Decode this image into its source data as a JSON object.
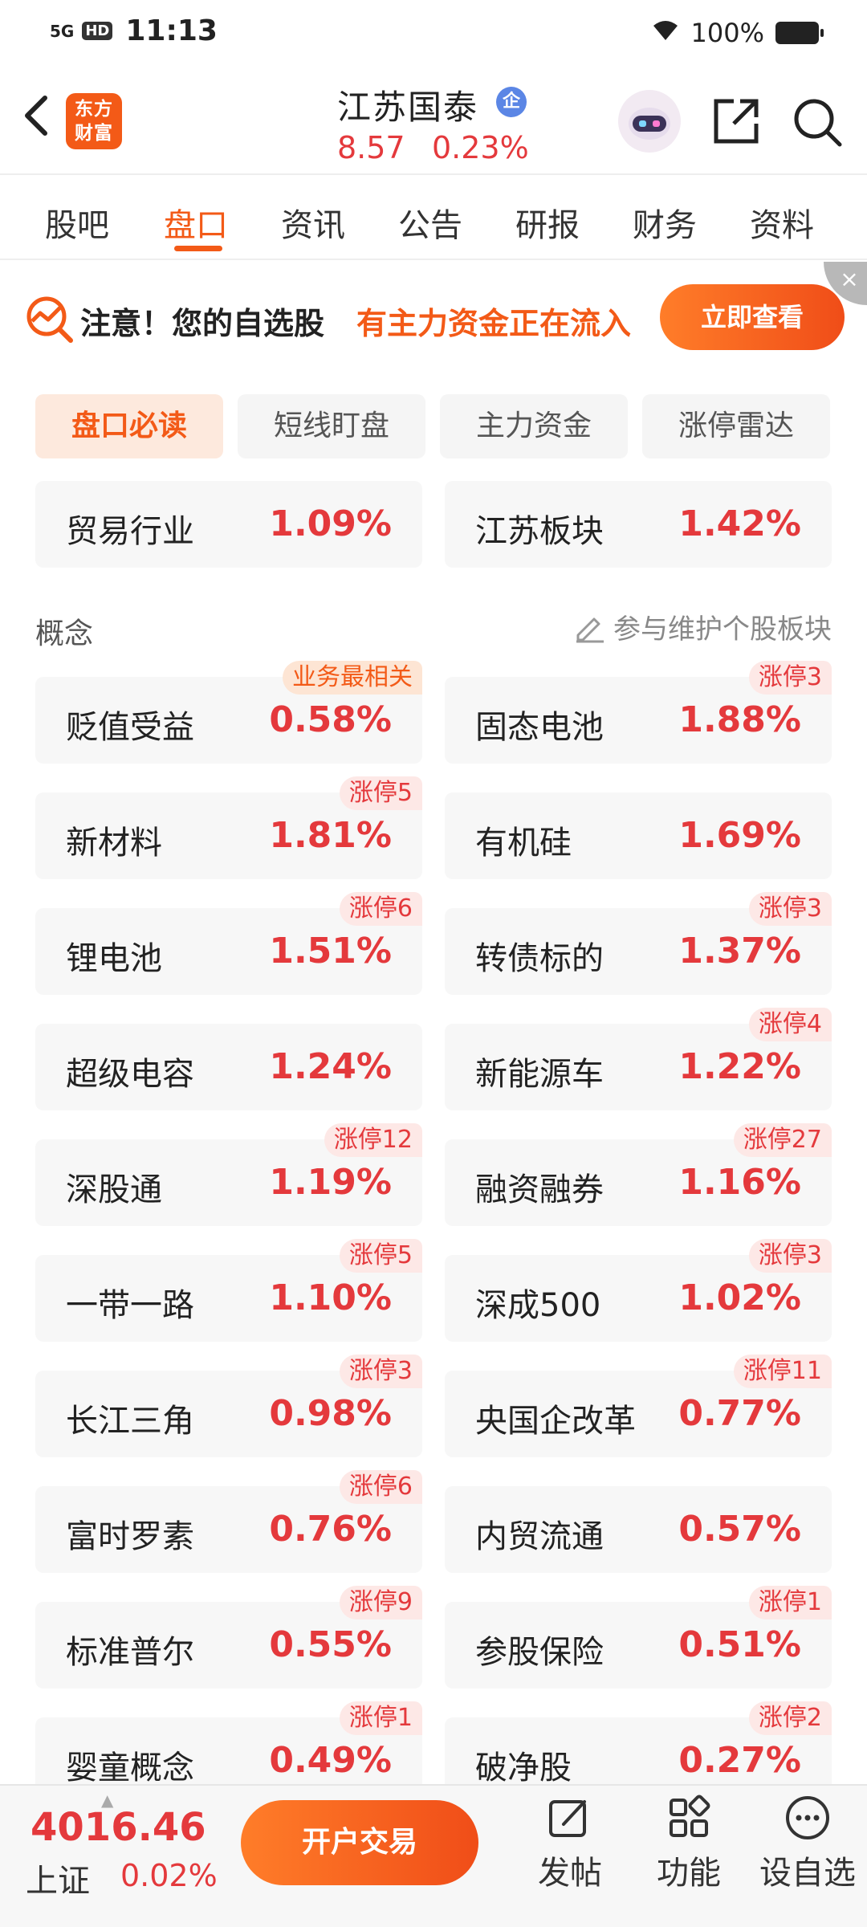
{
  "status_bar": {
    "signal": "5G",
    "hd": "HD",
    "time": "11:13",
    "battery": "100%"
  },
  "header": {
    "logo": "东方\n财富",
    "stock_name": "江苏国泰",
    "badge": "企",
    "price": "8.57",
    "change": "0.23%"
  },
  "tabs": [
    {
      "label": "股吧"
    },
    {
      "label": "盘口"
    },
    {
      "label": "资讯"
    },
    {
      "label": "公告"
    },
    {
      "label": "研报"
    },
    {
      "label": "财务"
    },
    {
      "label": "资料"
    }
  ],
  "active_tab": "盘口",
  "banner": {
    "text": "注意！您的自选股",
    "highlight": "有主力资金正在流入",
    "button": "立即查看",
    "close": "×"
  },
  "subtabs": [
    {
      "label": "盘口必读"
    },
    {
      "label": "短线盯盘"
    },
    {
      "label": "主力资金"
    },
    {
      "label": "涨停雷达"
    }
  ],
  "industry": [
    {
      "name": "贸易行业",
      "pct": "1.09%"
    },
    {
      "name": "江苏板块",
      "pct": "1.42%"
    }
  ],
  "concept_section": {
    "label": "概念",
    "link": "参与维护个股板块"
  },
  "concepts": [
    {
      "name": "贬值受益",
      "pct": "0.58%",
      "badge": "业务最相关"
    },
    {
      "name": "固态电池",
      "pct": "1.88%",
      "badge": "涨停3"
    },
    {
      "name": "新材料",
      "pct": "1.81%",
      "badge": "涨停5"
    },
    {
      "name": "有机硅",
      "pct": "1.69%",
      "badge": ""
    },
    {
      "name": "锂电池",
      "pct": "1.51%",
      "badge": "涨停6"
    },
    {
      "name": "转债标的",
      "pct": "1.37%",
      "badge": "涨停3"
    },
    {
      "name": "超级电容",
      "pct": "1.24%",
      "badge": ""
    },
    {
      "name": "新能源车",
      "pct": "1.22%",
      "badge": "涨停4"
    },
    {
      "name": "深股通",
      "pct": "1.19%",
      "badge": "涨停12"
    },
    {
      "name": "融资融券",
      "pct": "1.16%",
      "badge": "涨停27"
    },
    {
      "name": "一带一路",
      "pct": "1.10%",
      "badge": "涨停5"
    },
    {
      "name": "深成500",
      "pct": "1.02%",
      "badge": "涨停3"
    },
    {
      "name": "长江三角",
      "pct": "0.98%",
      "badge": "涨停3"
    },
    {
      "name": "央国企改革",
      "pct": "0.77%",
      "badge": "涨停11"
    },
    {
      "name": "富时罗素",
      "pct": "0.76%",
      "badge": "涨停6"
    },
    {
      "name": "内贸流通",
      "pct": "0.57%",
      "badge": ""
    },
    {
      "name": "标准普尔",
      "pct": "0.55%",
      "badge": "涨停9"
    },
    {
      "name": "参股保险",
      "pct": "0.51%",
      "badge": "涨停1"
    },
    {
      "name": "婴童概念",
      "pct": "0.49%",
      "badge": "涨停1"
    },
    {
      "name": "破净股",
      "pct": "0.27%",
      "badge": "涨停2"
    }
  ],
  "bottom_bar": {
    "index_value": "4016.46",
    "index_name": "上证",
    "index_change": "0.02%",
    "trade_button": "开户交易",
    "post": "发帖",
    "functions": "功能",
    "watchlist": "设自选"
  },
  "colors": {
    "accent": "#f35a17",
    "up": "#e4393c"
  }
}
